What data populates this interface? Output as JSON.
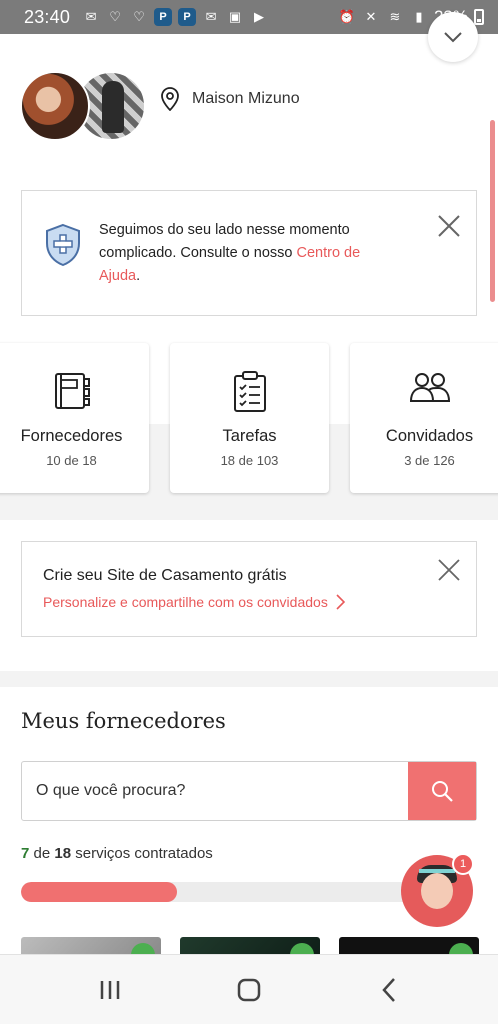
{
  "status_bar": {
    "time": "23:40",
    "battery_percent": "23%",
    "left_icons": [
      "mail-app-icon",
      "vine-icon",
      "vine-icon",
      "app-badge-icon",
      "app-badge-icon",
      "gmail-icon",
      "gallery-icon",
      "youtube-icon"
    ],
    "right_icons": [
      "alarm-icon",
      "mute-icon",
      "wifi-icon",
      "signal-icon",
      "battery-icon"
    ]
  },
  "header": {
    "venue_name": "Maison Mizuno"
  },
  "info_card": {
    "message": "Seguimos do seu lado nesse momento complicado. Consulte o nosso ",
    "link_text": "Centro de Ajuda",
    "suffix": "."
  },
  "summary": {
    "cards": [
      {
        "title": "Fornecedores",
        "count": "10 de 18",
        "icon": "notebook-icon"
      },
      {
        "title": "Tarefas",
        "count": "18 de 103",
        "icon": "checklist-icon"
      },
      {
        "title": "Convidados",
        "count": "3 de 126",
        "icon": "guests-icon"
      }
    ]
  },
  "site_promo": {
    "title": "Crie seu Site de Casamento grátis",
    "link": "Personalize e compartilhe com os convidados"
  },
  "vendors": {
    "section_title": "Meus fornecedores",
    "search_placeholder": "O que você procura?",
    "progress": {
      "done": "7",
      "of": "de",
      "total": "18",
      "suffix": "serviços contratados",
      "fraction": 0.389
    },
    "assistant_badge": "1"
  },
  "colors": {
    "accent": "#E8595A",
    "search_button": "#F07171",
    "progress_fill": "#F07070",
    "done_green": "#2E7D32",
    "status_bar": "#7B7B7B"
  },
  "nav_bar": {
    "buttons": [
      "recent-apps-icon",
      "home-icon",
      "back-icon"
    ]
  }
}
